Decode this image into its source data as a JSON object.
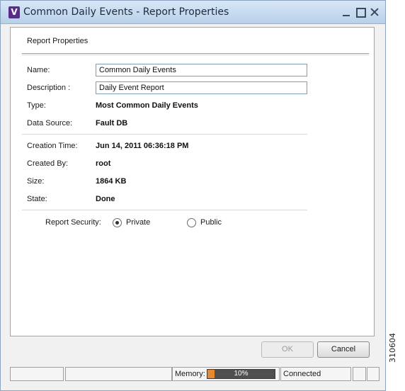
{
  "window": {
    "title": "Common Daily Events - Report Properties",
    "app_icon_letter": "V"
  },
  "panel": {
    "title": "Report Properties",
    "fields": {
      "name": {
        "label": "Name:",
        "value": "Common Daily Events"
      },
      "description": {
        "label": "Description :",
        "value": "Daily Event Report"
      },
      "type": {
        "label": "Type:",
        "value": "Most Common Daily Events"
      },
      "data_source": {
        "label": "Data Source:",
        "value": "Fault DB"
      },
      "creation_time": {
        "label": "Creation Time:",
        "value": "Jun 14, 2011 06:36:18 PM"
      },
      "created_by": {
        "label": "Created By:",
        "value": "root"
      },
      "size": {
        "label": "Size:",
        "value": "1864 KB"
      },
      "state": {
        "label": "State:",
        "value": "Done"
      }
    },
    "security": {
      "label": "Report Security:",
      "options": [
        "Private",
        "Public"
      ],
      "selected": "Private"
    }
  },
  "buttons": {
    "ok": "OK",
    "cancel": "Cancel",
    "ok_enabled": false
  },
  "statusbar": {
    "memory_label": "Memory:",
    "memory_text": "10%",
    "memory_fraction": 0.1,
    "connection": "Connected"
  },
  "figure_id": "310604"
}
